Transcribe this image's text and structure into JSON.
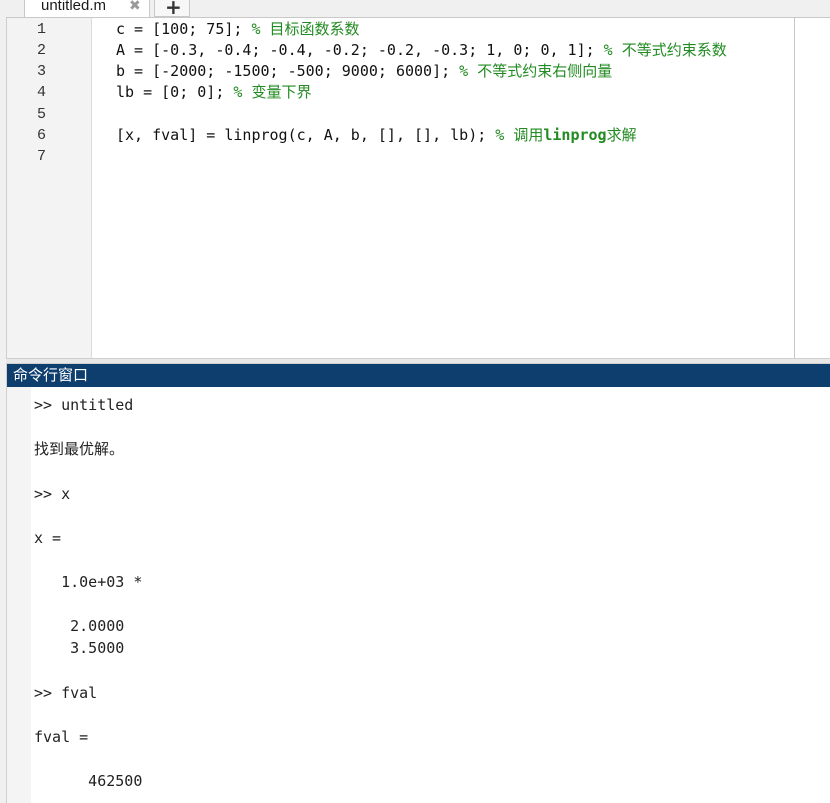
{
  "editor": {
    "tab": {
      "label": "untitled.m",
      "close": "✖"
    },
    "add_tab": "+",
    "line_numbers": [
      "1",
      "2",
      "3",
      "4",
      "5",
      "6",
      "7"
    ],
    "lines": [
      {
        "code": "c = [100; 75]; ",
        "comment": "% 目标函数系数"
      },
      {
        "code": "A = [-0.3, -0.4; -0.4, -0.2; -0.2, -0.3; 1, 0; 0, 1]; ",
        "comment": "% 不等式约束系数"
      },
      {
        "code": "b = [-2000; -1500; -500; 9000; 6000]; ",
        "comment": "% 不等式约束右侧向量"
      },
      {
        "code": "lb = [0; 0]; ",
        "comment": "% 变量下界"
      },
      {
        "code": "",
        "comment": ""
      },
      {
        "code": "[x, fval] = linprog(c, A, b, [], [], lb); ",
        "comment_prefix": "% 调用",
        "comment_bold": "linprog",
        "comment_suffix": "求解"
      },
      {
        "code": "",
        "comment": ""
      }
    ]
  },
  "command_window": {
    "title": "命令行窗口",
    "lines": [
      ">> untitled",
      "",
      "找到最优解。",
      "",
      ">> x",
      "",
      "x =",
      "",
      "   1.0e+03 *",
      "",
      "    2.0000",
      "    3.5000",
      "",
      ">> fval",
      "",
      "fval =",
      "",
      "      462500"
    ]
  },
  "colors": {
    "comment": "#228b22",
    "command_title_bg": "#0d3e6e"
  }
}
